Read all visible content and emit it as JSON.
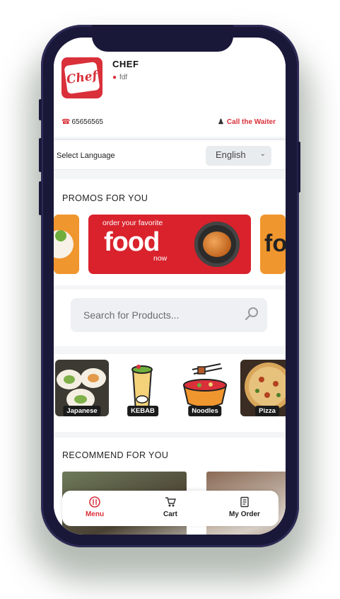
{
  "restaurant": {
    "name": "CHEF",
    "location": "fdf",
    "logo_text": "Chef",
    "phone": "65656565",
    "call_waiter_label": "Call the Waiter"
  },
  "language": {
    "label": "Select Language",
    "selected": "English"
  },
  "promos": {
    "title": "PROMOS FOR YOU",
    "banner_line1": "order your favorite",
    "banner_line2": "food",
    "banner_line3": "now",
    "side_partial_text": "fo"
  },
  "search": {
    "placeholder": "Search for Products..."
  },
  "categories": [
    {
      "label": "Japanese"
    },
    {
      "label": "KEBAB"
    },
    {
      "label": "Noodles"
    },
    {
      "label": "Pizza"
    }
  ],
  "recommend": {
    "title": "RECOMMEND FOR YOU"
  },
  "bottom_nav": {
    "items": [
      {
        "label": "Menu",
        "icon": "menu-icon",
        "active": true
      },
      {
        "label": "Cart",
        "icon": "cart-icon",
        "active": false
      },
      {
        "label": "My Order",
        "icon": "order-icon",
        "active": false
      }
    ]
  },
  "colors": {
    "accent": "#d9303a",
    "phone_frame": "#1a1838",
    "background": "#f4f5f7"
  }
}
